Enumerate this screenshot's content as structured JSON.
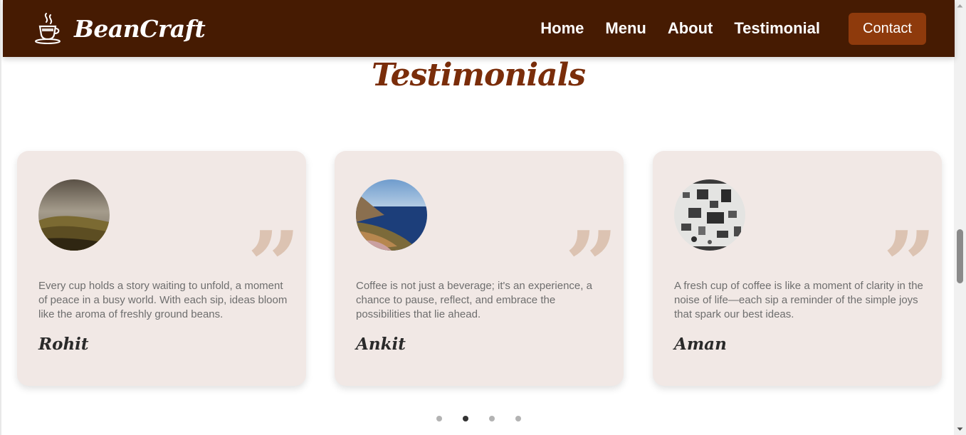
{
  "header": {
    "brand": "BeanCraft",
    "logo_icon": "coffee-cup-icon",
    "nav": [
      "Home",
      "Menu",
      "About",
      "Testimonial"
    ],
    "contact_label": "Contact",
    "bg_color": "#461b02",
    "contact_color": "#8e3a0c"
  },
  "section": {
    "title": "Testimonials",
    "title_color": "#7a2d0a"
  },
  "testimonials": [
    {
      "name": "Rohit",
      "text": "Every cup holds a story waiting to unfold, a moment of peace in a busy world. With each sip, ideas bloom like the aroma of freshly ground beans.",
      "avatar": "foggy-hillside-photo"
    },
    {
      "name": "Ankit",
      "text": "Coffee is not just a beverage; it's an experience, a chance to pause, reflect, and embrace the possibilities that lie ahead.",
      "avatar": "coastal-cliff-photo"
    },
    {
      "name": "Aman",
      "text": "A fresh cup of coffee is like a moment of clarity in the noise of life—each sip a reminder of the simple joys that spark our best ideas.",
      "avatar": "flat-lay-gadgets-photo"
    }
  ],
  "quote_icon": "closing-quote-icon",
  "pagination": {
    "count": 4,
    "active_index": 1
  },
  "card_bg": "#f1e8e5"
}
